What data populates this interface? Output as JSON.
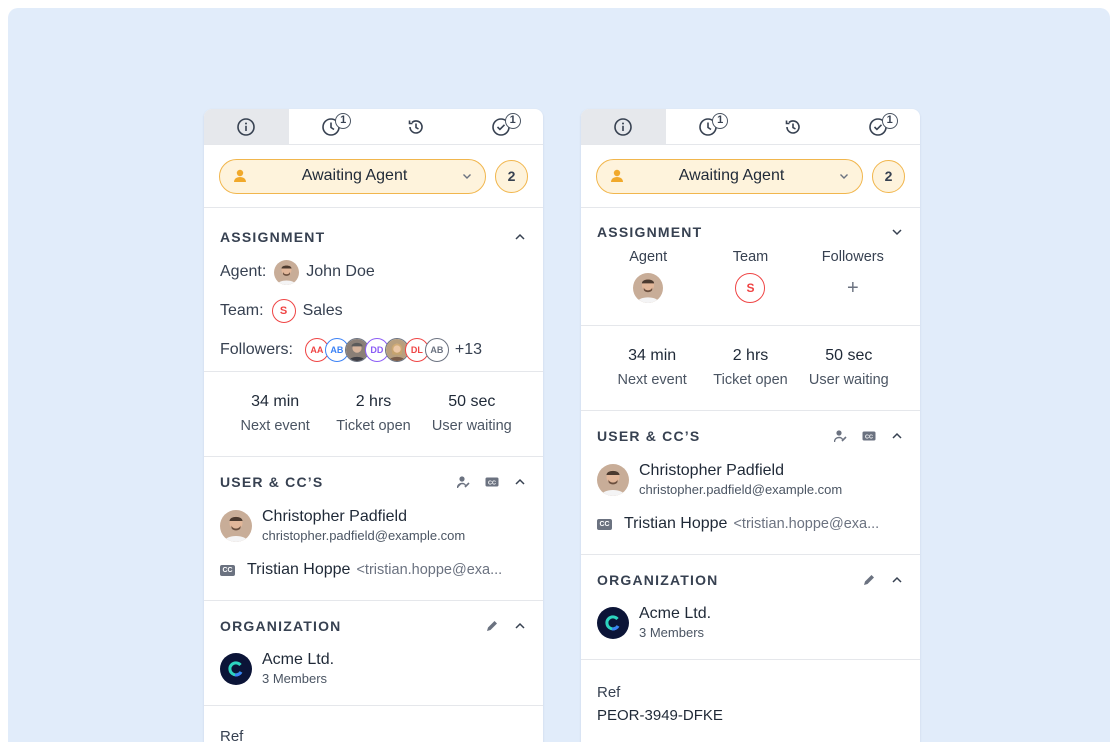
{
  "colors": {
    "background": "#e1ecfa",
    "status_border": "#f1b64d",
    "status_fill": "#fef3dc",
    "team_red": "#ef4444"
  },
  "tabs": [
    {
      "icon": "info-icon",
      "badge": ""
    },
    {
      "icon": "clock-icon",
      "badge": "1"
    },
    {
      "icon": "history-icon",
      "badge": ""
    },
    {
      "icon": "check-circle-icon",
      "badge": "1"
    }
  ],
  "status": {
    "label": "Awaiting Agent",
    "count": "2"
  },
  "assignment": {
    "title": "ASSIGNMENT",
    "agent_label": "Agent:",
    "agent_name": "John Doe",
    "team_label": "Team:",
    "team_initial": "S",
    "team_name": "Sales",
    "followers_label": "Followers:",
    "followers": [
      {
        "initials": "AA",
        "color": "#ef4444"
      },
      {
        "initials": "AB",
        "color": "#3b82f6"
      },
      {
        "initials": "",
        "color": "#6b7280"
      },
      {
        "initials": "DD",
        "color": "#8b5cf6"
      },
      {
        "initials": "",
        "color": "#6b7280"
      },
      {
        "initials": "DL",
        "color": "#ef4444"
      },
      {
        "initials": "AB",
        "color": "#6b7280"
      }
    ],
    "followers_more": "+13",
    "col_agent": "Agent",
    "col_team": "Team",
    "col_followers": "Followers",
    "add_symbol": "+"
  },
  "timers": [
    {
      "value": "34 min",
      "label": "Next event"
    },
    {
      "value": "2 hrs",
      "label": "Ticket open"
    },
    {
      "value": "50 sec",
      "label": "User waiting"
    }
  ],
  "users": {
    "title": "USER & CC’S",
    "user_name": "Christopher Padfield",
    "user_email": "christopher.padfield@example.com",
    "cc_badge": "CC",
    "cc_name": "Tristian Hoppe",
    "cc_email": "<tristian.hoppe@exa..."
  },
  "organization": {
    "title": "ORGANIZATION",
    "name": "Acme Ltd.",
    "members": "3 Members"
  },
  "ref": {
    "label": "Ref",
    "value": "PEOR-3949-DFKE"
  }
}
